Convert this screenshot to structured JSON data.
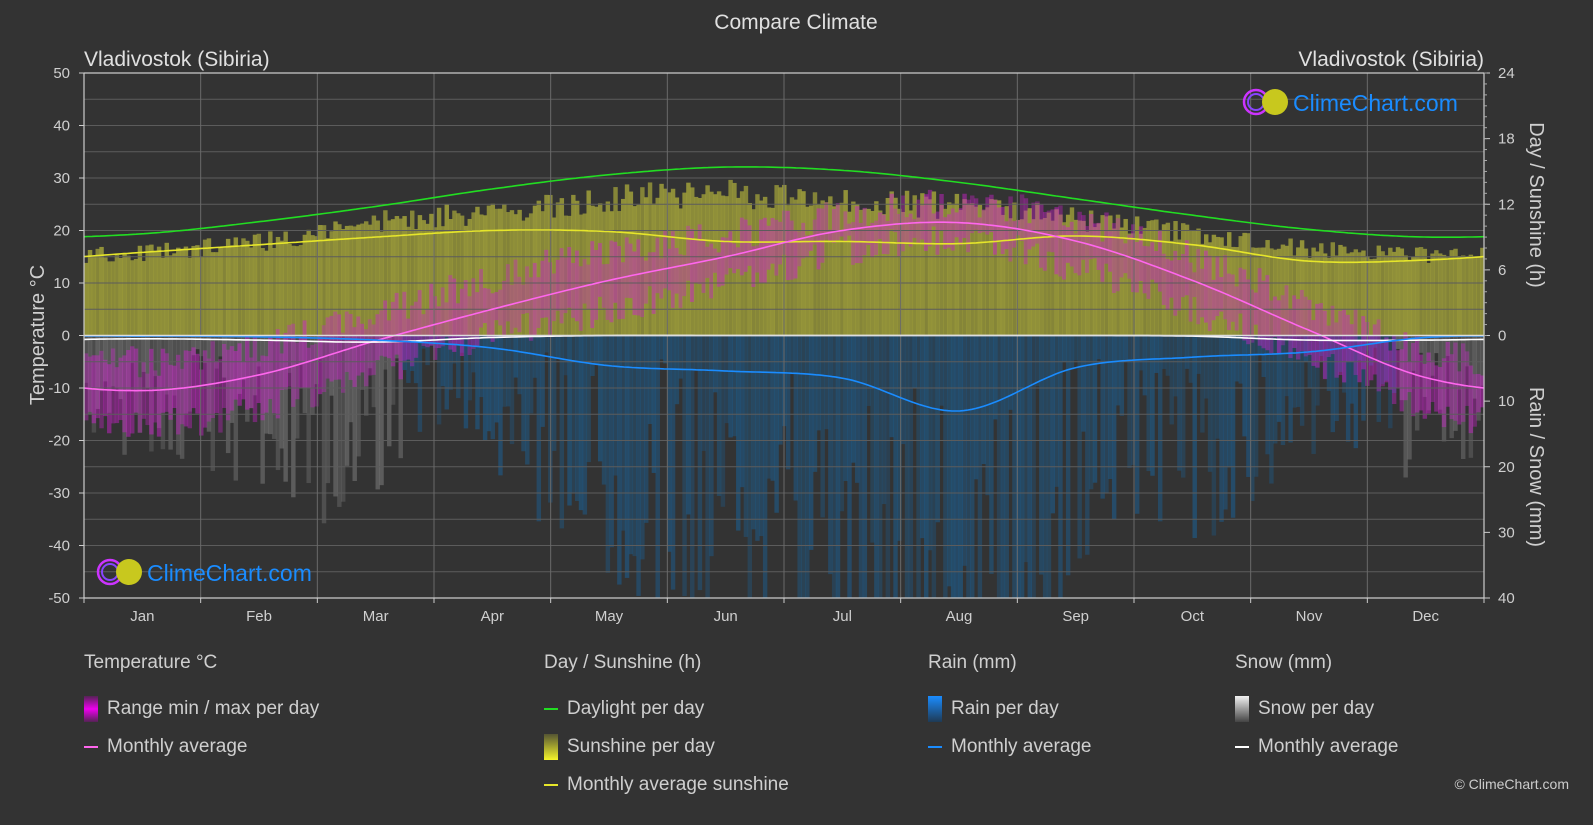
{
  "title": "Compare Climate",
  "location_left": "Vladivostok (Sibiria)",
  "location_right": "Vladivostok (Sibiria)",
  "watermark": "ClimeChart.com",
  "copyright": "© ClimeChart.com",
  "colors": {
    "background": "#333333",
    "daylight": "#22dd22",
    "sunshine_line": "#e6e62a",
    "sunshine_fill": "#9a9a3a",
    "temp_line": "#ff66ee",
    "temp_fill": "#cc22cc",
    "rain_line": "#1a8cff",
    "rain_fill": "#1e5a88",
    "snow_line": "#ffffff",
    "snow_fill": "#777777",
    "brand_blue": "#1a8cff"
  },
  "legend": {
    "temperature": {
      "header": "Temperature °C",
      "items": [
        {
          "label": "Range min / max per day"
        },
        {
          "label": "Monthly average"
        }
      ]
    },
    "sunshine": {
      "header": "Day / Sunshine (h)",
      "items": [
        {
          "label": "Daylight per day"
        },
        {
          "label": "Sunshine per day"
        },
        {
          "label": "Monthly average sunshine"
        }
      ]
    },
    "rain": {
      "header": "Rain (mm)",
      "items": [
        {
          "label": "Rain per day"
        },
        {
          "label": "Monthly average"
        }
      ]
    },
    "snow": {
      "header": "Snow (mm)",
      "items": [
        {
          "label": "Snow per day"
        },
        {
          "label": "Monthly average"
        }
      ]
    }
  },
  "chart_data": {
    "type": "line",
    "title": "Compare Climate",
    "categories": [
      "Jan",
      "Feb",
      "Mar",
      "Apr",
      "May",
      "Jun",
      "Jul",
      "Aug",
      "Sep",
      "Oct",
      "Nov",
      "Dec"
    ],
    "axes": {
      "left": {
        "label": "Temperature °C",
        "range": [
          -50,
          50
        ],
        "ticks": [
          50,
          40,
          30,
          20,
          10,
          0,
          -10,
          -20,
          -30,
          -40,
          -50
        ]
      },
      "right_top": {
        "label": "Day / Sunshine (h)",
        "range": [
          0,
          24
        ],
        "ticks": [
          24,
          18,
          12,
          6,
          0
        ]
      },
      "right_bottom": {
        "label": "Rain / Snow (mm)",
        "range": [
          0,
          40
        ],
        "ticks": [
          0,
          10,
          20,
          30,
          40
        ]
      }
    },
    "grid": true,
    "series": [
      {
        "name": "Temperature monthly average",
        "axis": "left",
        "unit": "°C",
        "values": [
          -10.5,
          -7.5,
          -1.0,
          5.0,
          10.5,
          15.0,
          20.0,
          21.5,
          18.0,
          10.5,
          1.0,
          -8.0
        ]
      },
      {
        "name": "Temperature daily max (approx)",
        "axis": "left",
        "unit": "°C",
        "values": [
          -5,
          -2,
          4,
          11,
          16,
          19,
          23,
          25,
          22,
          15,
          6,
          -3
        ]
      },
      {
        "name": "Temperature daily min (approx)",
        "axis": "left",
        "unit": "°C",
        "values": [
          -17,
          -14,
          -7,
          0,
          5,
          10,
          16,
          18,
          13,
          5,
          -4,
          -14
        ]
      },
      {
        "name": "Daylight per day",
        "axis": "right_top",
        "unit": "h",
        "values": [
          9.3,
          10.4,
          11.8,
          13.4,
          14.7,
          15.4,
          15.1,
          14.0,
          12.5,
          11.0,
          9.7,
          9.0
        ]
      },
      {
        "name": "Sunshine per day (upper envelope)",
        "axis": "right_top",
        "unit": "h",
        "values": [
          8.0,
          9.0,
          10.8,
          12.0,
          13.2,
          13.6,
          13.0,
          12.4,
          11.2,
          9.8,
          8.3,
          7.8
        ]
      },
      {
        "name": "Monthly average sunshine",
        "axis": "right_top",
        "unit": "h",
        "values": [
          7.6,
          8.3,
          9.0,
          9.6,
          9.5,
          8.6,
          8.6,
          8.4,
          9.1,
          8.3,
          6.8,
          6.9
        ]
      },
      {
        "name": "Rain monthly average",
        "axis": "right_bottom",
        "unit": "mm",
        "values": [
          0.1,
          0.2,
          0.7,
          1.9,
          4.6,
          5.4,
          6.5,
          11.5,
          4.9,
          3.3,
          2.5,
          0.3
        ]
      },
      {
        "name": "Snow monthly average",
        "axis": "right_bottom",
        "unit": "mm",
        "values": [
          0.5,
          0.7,
          1.0,
          0.3,
          0.0,
          0.0,
          0.0,
          0.0,
          0.0,
          0.1,
          0.7,
          0.7
        ]
      }
    ],
    "legend_position": "bottom"
  }
}
